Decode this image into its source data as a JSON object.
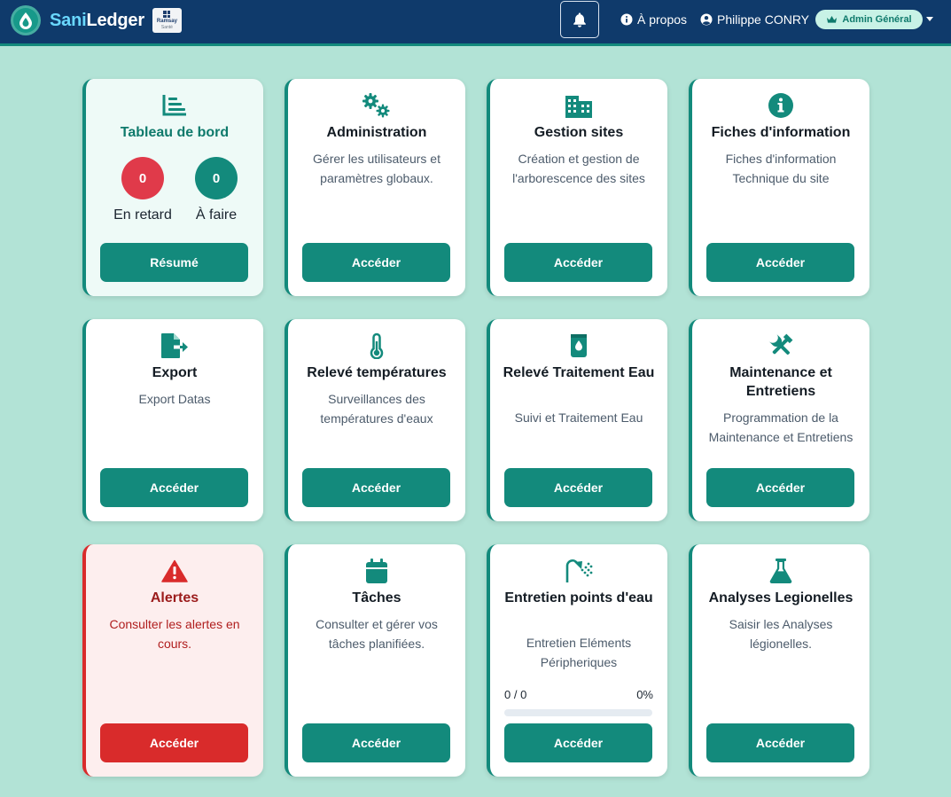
{
  "app": {
    "brand_first": "Sani",
    "brand_second": "Ledger",
    "partner_line1": "Ramsay",
    "partner_line2": "Santé"
  },
  "nav": {
    "about_label": "À propos",
    "user_name": "Philippe CONRY",
    "role_label": "Admin Général"
  },
  "colors": {
    "primary": "#138a7c",
    "navbar": "#0f3a6b",
    "background": "#b2e3d6",
    "danger": "#d92b2b",
    "late_counter": "#e03a4a"
  },
  "dashboard": {
    "title": "Tableau de bord",
    "late_count": "0",
    "late_label": "En retard",
    "todo_count": "0",
    "todo_label": "À faire",
    "button": "Résumé",
    "icon": "chart-bar-icon"
  },
  "cards": {
    "administration": {
      "title": "Administration",
      "desc": "Gérer les utilisateurs et paramètres globaux.",
      "button": "Accéder",
      "icon": "gears-icon"
    },
    "sites": {
      "title": "Gestion sites",
      "desc": "Création et gestion de l'arborescence des sites",
      "button": "Accéder",
      "icon": "building-icon"
    },
    "fiches": {
      "title": "Fiches d'information",
      "desc": "Fiches d'information Technique du site",
      "button": "Accéder",
      "icon": "info-circle-icon"
    },
    "export": {
      "title": "Export",
      "desc": "Export Datas",
      "button": "Accéder",
      "icon": "file-export-icon"
    },
    "temperatures": {
      "title": "Relevé températures",
      "desc": "Surveillances des températures d'eaux",
      "button": "Accéder",
      "icon": "thermometer-icon"
    },
    "traitement": {
      "title": "Relevé Traitement Eau",
      "desc": "Suivi et Traitement Eau",
      "button": "Accéder",
      "icon": "bottle-droplet-icon"
    },
    "maintenance": {
      "title": "Maintenance et Entretiens",
      "desc": "Programmation de la Maintenance et Entretiens",
      "button": "Accéder",
      "icon": "tools-icon"
    },
    "alertes": {
      "title": "Alertes",
      "desc": "Consulter les alertes en cours.",
      "button": "Accéder",
      "icon": "warning-triangle-icon"
    },
    "taches": {
      "title": "Tâches",
      "desc": "Consulter et gérer vos tâches planifiées.",
      "button": "Accéder",
      "icon": "calendar-icon"
    },
    "points_eau": {
      "title": "Entretien points d'eau",
      "desc": "Entretien Eléments Péripheriques",
      "button": "Accéder",
      "icon": "shower-icon",
      "progress_count": "0 / 0",
      "progress_percent": "0%",
      "progress_value": 0
    },
    "legionelles": {
      "title": "Analyses Legionelles",
      "desc": "Saisir les Analyses légionelles.",
      "button": "Accéder",
      "icon": "flask-icon"
    }
  }
}
